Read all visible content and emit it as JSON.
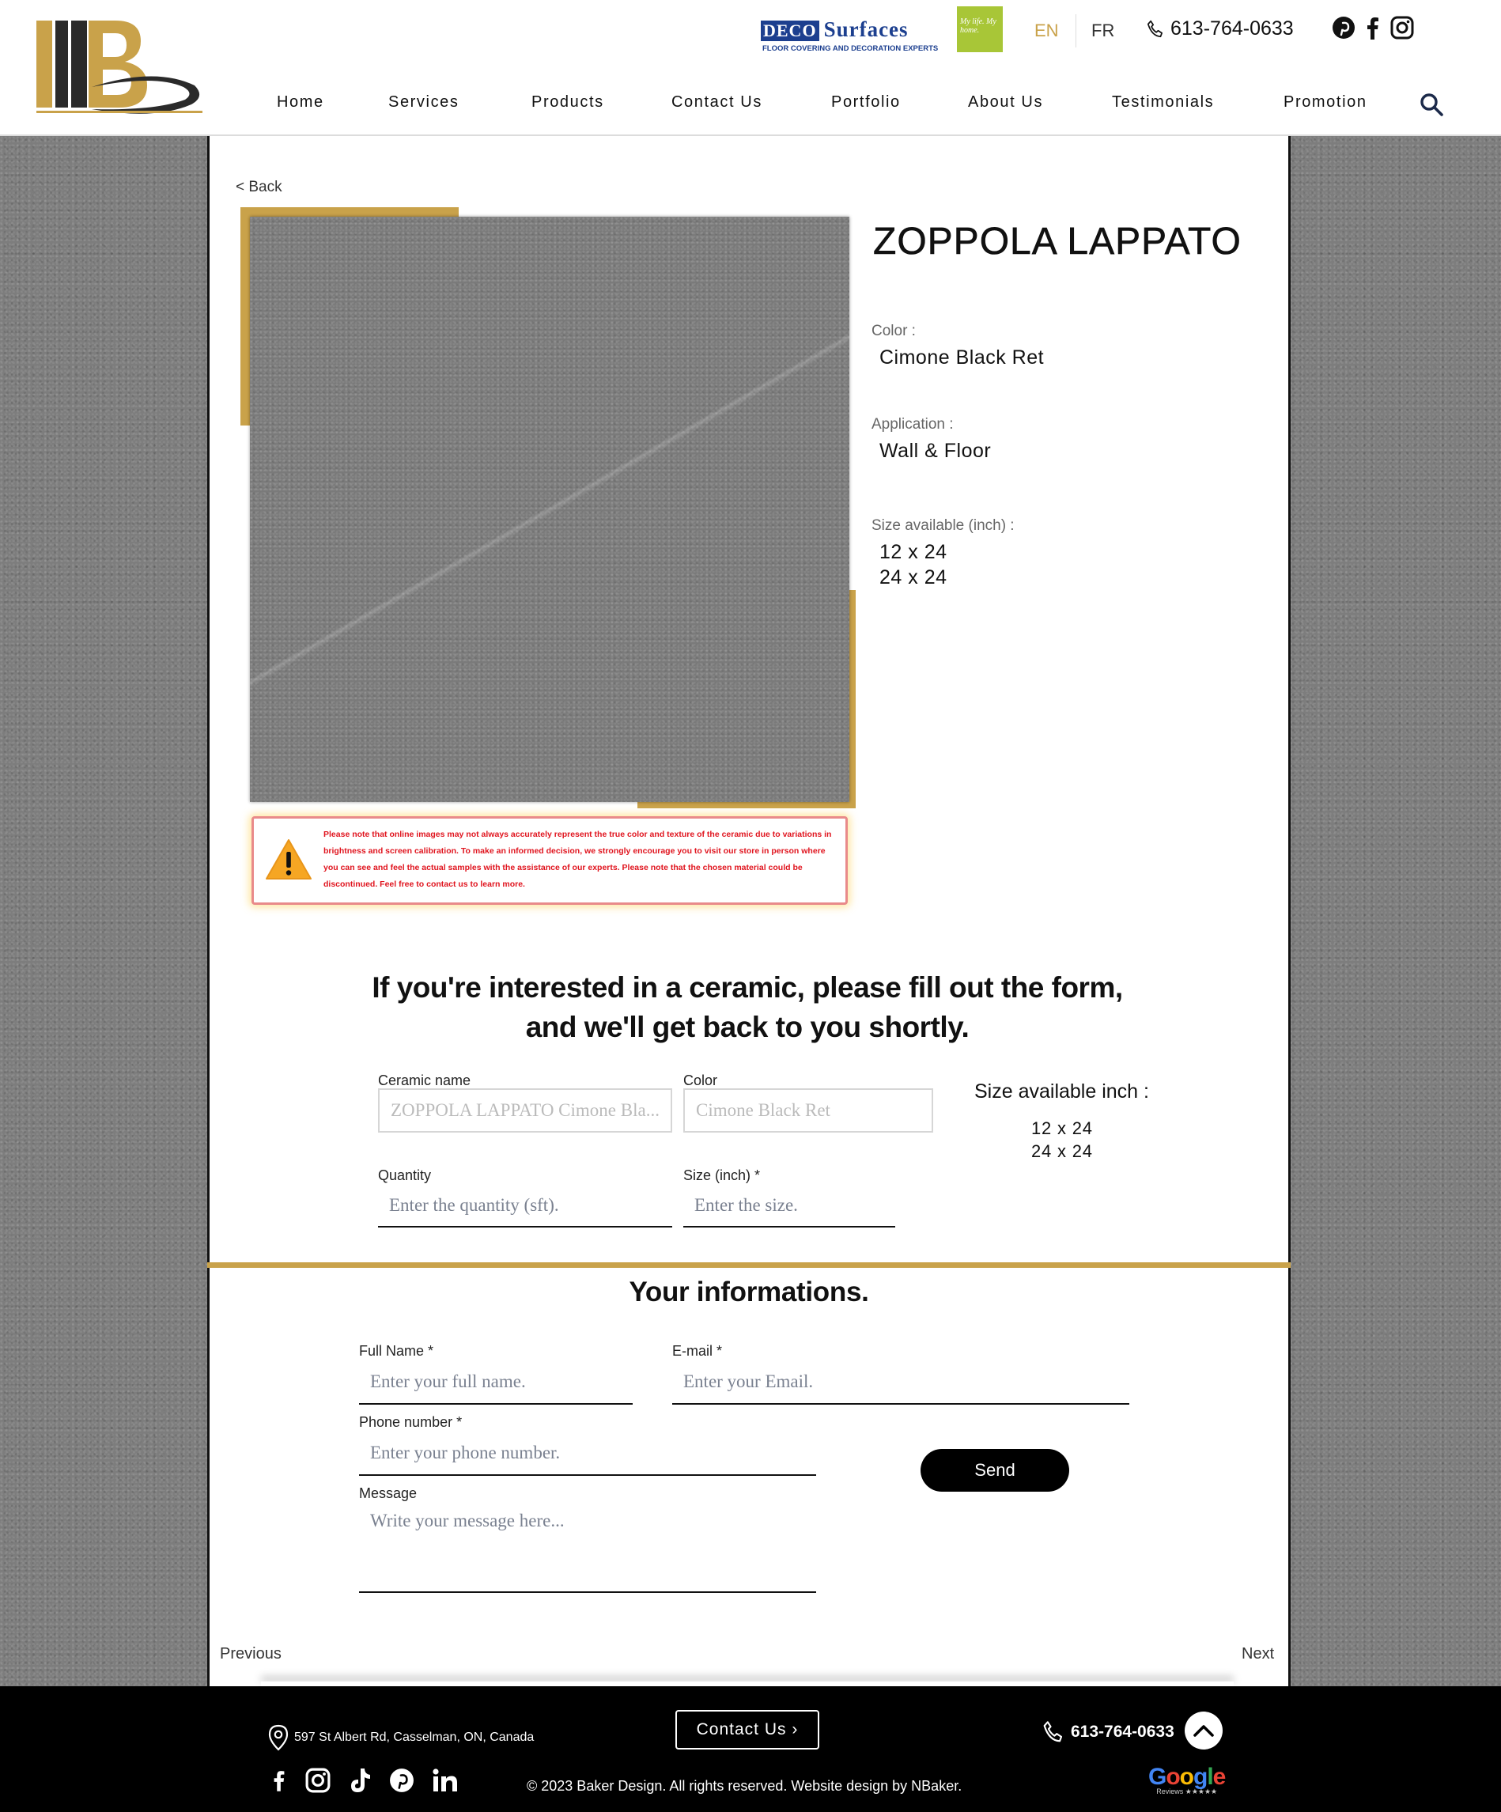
{
  "header": {
    "logo_alt": "Baker Design",
    "partner": {
      "brand_a": "DECO",
      "brand_b": "Surfaces",
      "tagline": "FLOOR COVERING AND DECORATION EXPERTS",
      "badge": "My life. My home."
    },
    "lang_en": "EN",
    "lang_fr": "FR",
    "phone": "613-764-0633",
    "nav": [
      "Home",
      "Services",
      "Products",
      "Contact Us",
      "Portfolio",
      "About Us",
      "Testimonials",
      "Promotion"
    ]
  },
  "product": {
    "back_label": "< Back",
    "title": "ZOPPOLA LAPPATO",
    "color_label": "Color :",
    "color_value": "Cimone Black Ret",
    "application_label": "Application :",
    "application_value": "Wall & Floor",
    "sizes_label": "Size available (inch) :",
    "sizes": [
      "12 x 24",
      "24 x 24"
    ],
    "warning": "Please note that online images may not always accurately represent the true color and texture of the ceramic due to variations in brightness and screen calibration. To make an informed decision, we strongly encourage you to visit our store in person where you can see and feel the actual samples with the assistance of our experts. Please note that the chosen material could be discontinued. Feel free to contact us to learn more."
  },
  "form": {
    "heading": "If you're interested in a ceramic, please fill out the form, and we'll get back to you shortly.",
    "ceramic_label": "Ceramic name",
    "ceramic_value": "ZOPPOLA LAPPATO Cimone Bla...",
    "color_label": "Color",
    "color_value": "Cimone Black Ret",
    "sizes_title": "Size available inch :",
    "sizes": [
      "12 x 24",
      "24 x 24"
    ],
    "quantity_label": "Quantity",
    "quantity_placeholder": "Enter the quantity (sft).",
    "size_label": "Size (inch) *",
    "size_placeholder": "Enter the size."
  },
  "info": {
    "heading": "Your informations.",
    "fullname_label": "Full Name *",
    "fullname_placeholder": "Enter your full name.",
    "email_label": "E-mail *",
    "email_placeholder": "Enter your Email.",
    "phone_label": "Phone number *",
    "phone_placeholder": "Enter your phone number.",
    "message_label": "Message",
    "message_placeholder": "Write your message here...",
    "send_label": "Send"
  },
  "pager": {
    "previous": "Previous",
    "next": "Next"
  },
  "footer": {
    "address": "597 St Albert Rd, Casselman, ON, Canada",
    "contact_label": "Contact Us",
    "phone": "613-764-0633",
    "copyright": "© 2023 Baker Design. All rights reserved. Website design by NBaker.",
    "google": "Google",
    "google_sub": "Reviews ★★★★★"
  },
  "colors": {
    "gold": "#c9a24a",
    "warning_red": "#e0141e",
    "partner_blue": "#1c3f8f",
    "partner_green": "#a8c637"
  }
}
